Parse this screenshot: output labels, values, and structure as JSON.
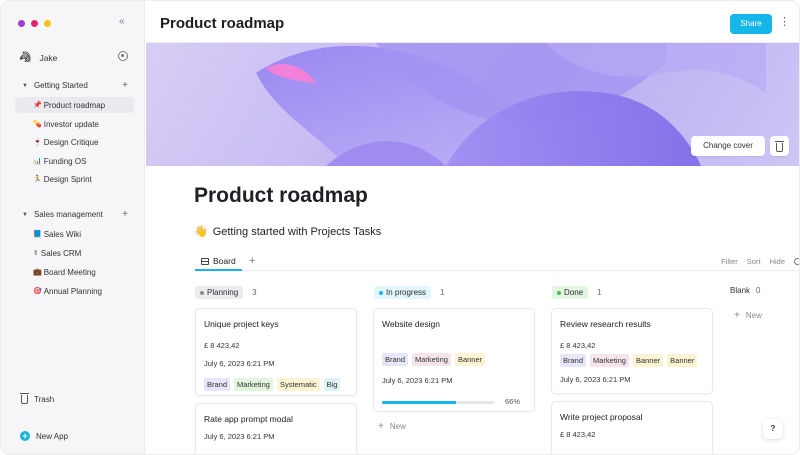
{
  "window": {
    "traffic_colors": [
      "#a43bd6",
      "#e0246e",
      "#f2c21d"
    ]
  },
  "sidebar": {
    "user": "Jake",
    "sections": [
      {
        "title": "Getting Started",
        "items": [
          {
            "emoji": "📌",
            "label": "Product roadmap",
            "active": true
          },
          {
            "emoji": "💊",
            "label": "Investor update"
          },
          {
            "emoji": "🍷",
            "label": "Design Critique"
          },
          {
            "emoji": "📊",
            "label": "Funding OS"
          },
          {
            "emoji": "🏃",
            "label": "Design Sprint"
          }
        ]
      },
      {
        "title": "Sales management",
        "items": [
          {
            "emoji": "📘",
            "label": "Sales Wiki"
          },
          {
            "emoji": "✌",
            "label": "Sales CRM"
          },
          {
            "emoji": "💼",
            "label": "Board Meeting"
          },
          {
            "emoji": "🎯",
            "label": "Annual Planning"
          }
        ]
      }
    ],
    "trash": "Trash",
    "new_app": "New App"
  },
  "header": {
    "title": "Product roadmap",
    "share": "Share",
    "more": "⋮"
  },
  "cover": {
    "change_cover": "Change cover"
  },
  "page": {
    "title": "Product roadmap",
    "subtitle_emoji": "👋",
    "subtitle": "Getting started with Projects Tasks"
  },
  "tabs": {
    "board": "Board",
    "add": "+",
    "filter": "Filter",
    "sort": "Sort",
    "hide": "Hide"
  },
  "columns": [
    {
      "status": "Planning",
      "count": "3",
      "color": "#8b8b94",
      "bg": "#ececef",
      "cards": [
        {
          "title": "Unique project keys",
          "amount": "£ 8 423,42",
          "date": "July 6, 2023 6:21 PM",
          "tags": [
            {
              "t": "Brand",
              "bg": "#e7e5f8"
            },
            {
              "t": "Marketing",
              "bg": "#e2f5df"
            },
            {
              "t": "Systematic",
              "bg": "#fbf4d3"
            },
            {
              "t": "Big",
              "bg": "#dcf3f6"
            }
          ]
        },
        {
          "title": "Rate app prompt modal",
          "amount": "",
          "date": "July 6, 2023 6:21 PM",
          "tags": []
        }
      ]
    },
    {
      "status": "In progress",
      "count": "1",
      "color": "#16b6e8",
      "bg": "#e3f6fc",
      "cards": [
        {
          "title": "Website design",
          "amount": "",
          "date": "July 6, 2023 6:21 PM",
          "tags": [
            {
              "t": "Brand",
              "bg": "#e7e5f8"
            },
            {
              "t": "Marketing",
              "bg": "#f6e4ec"
            },
            {
              "t": "Banner",
              "bg": "#fbf4d3"
            }
          ],
          "progress": 0.66,
          "progress_label": "66%"
        }
      ],
      "new": "New"
    },
    {
      "status": "Done",
      "count": "1",
      "color": "#4dbb4e",
      "bg": "#e3f6df",
      "cards": [
        {
          "title": "Review research results",
          "amount": "£ 8 423,42",
          "date": "July 6, 2023 6:21 PM",
          "tags": [
            {
              "t": "Brand",
              "bg": "#e7e5f8"
            },
            {
              "t": "Marketing",
              "bg": "#f6e4ec"
            },
            {
              "t": "Banner",
              "bg": "#fbf4d3"
            },
            {
              "t": "Banner",
              "bg": "#fbf4d3"
            }
          ]
        },
        {
          "title": "Write project proposal",
          "amount": "£ 8 423,42",
          "date": "",
          "tags": []
        }
      ]
    },
    {
      "status": "Blank",
      "count": "0",
      "new": "New"
    }
  ],
  "help": "?"
}
